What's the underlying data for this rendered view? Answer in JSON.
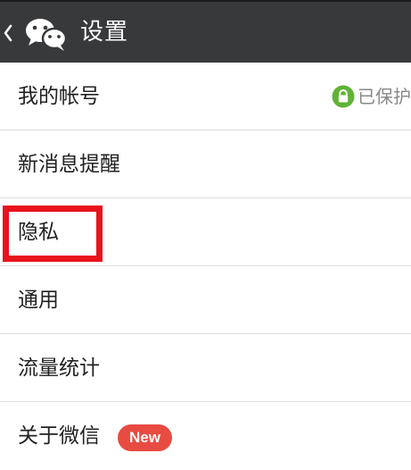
{
  "header": {
    "title": "设置",
    "back_icon": "chevron-left-icon",
    "logo_icon": "wechat-logo-icon"
  },
  "menu": {
    "items": [
      {
        "label": "我的帐号",
        "status": "已保护",
        "status_icon": "lock-icon"
      },
      {
        "label": "新消息提醒"
      },
      {
        "label": "隐私"
      },
      {
        "label": "通用"
      },
      {
        "label": "流量统计"
      },
      {
        "label": "关于微信",
        "badge": "New"
      }
    ]
  },
  "colors": {
    "header_bg": "#38393b",
    "status_green": "#5fb336",
    "badge_red": "#e84b42",
    "highlight_red": "#e8131c"
  }
}
